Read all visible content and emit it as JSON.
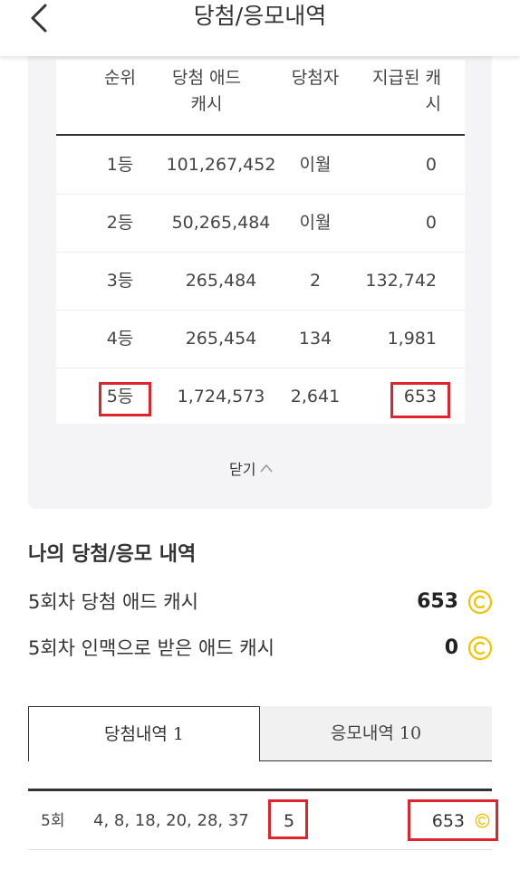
{
  "header": {
    "title": "당첨/응모내역",
    "back_icon": "chevron-left-icon"
  },
  "prize_table": {
    "columns": [
      "순위",
      "당첨 애드\n캐시",
      "당첨자",
      "지급된 캐\n시"
    ],
    "rows": [
      {
        "rank": "1등",
        "prize_cash": "101,267,452",
        "winners": "이월",
        "paid_cash": "0"
      },
      {
        "rank": "2등",
        "prize_cash": "50,265,484",
        "winners": "이월",
        "paid_cash": "0"
      },
      {
        "rank": "3등",
        "prize_cash": "265,484",
        "winners": "2",
        "paid_cash": "132,742"
      },
      {
        "rank": "4등",
        "prize_cash": "265,454",
        "winners": "134",
        "paid_cash": "1,981"
      },
      {
        "rank": "5등",
        "prize_cash": "1,724,573",
        "winners": "2,641",
        "paid_cash": "653"
      }
    ],
    "close_label": "닫기",
    "close_icon": "chevron-up-icon"
  },
  "my_history": {
    "title": "나의 당첨/응모 내역",
    "items": [
      {
        "label": "5회차 당첨 애드 캐시",
        "value": "653",
        "icon": "coin-icon"
      },
      {
        "label": "5회차 인맥으로 받은 애드 캐시",
        "value": "0",
        "icon": "coin-icon"
      }
    ]
  },
  "tabs": [
    {
      "label": "당첨내역 1",
      "active": true
    },
    {
      "label": "응모내역 10",
      "active": false
    }
  ],
  "history_rows": [
    {
      "round": "5회",
      "numbers": "4, 8, 18, 20, 28, 37",
      "match": "5",
      "amount": "653",
      "icon": "coin-icon"
    }
  ],
  "colors": {
    "highlight": "#e0242d",
    "coin": "#f2c200",
    "panel_bg": "#f4f4f6"
  }
}
